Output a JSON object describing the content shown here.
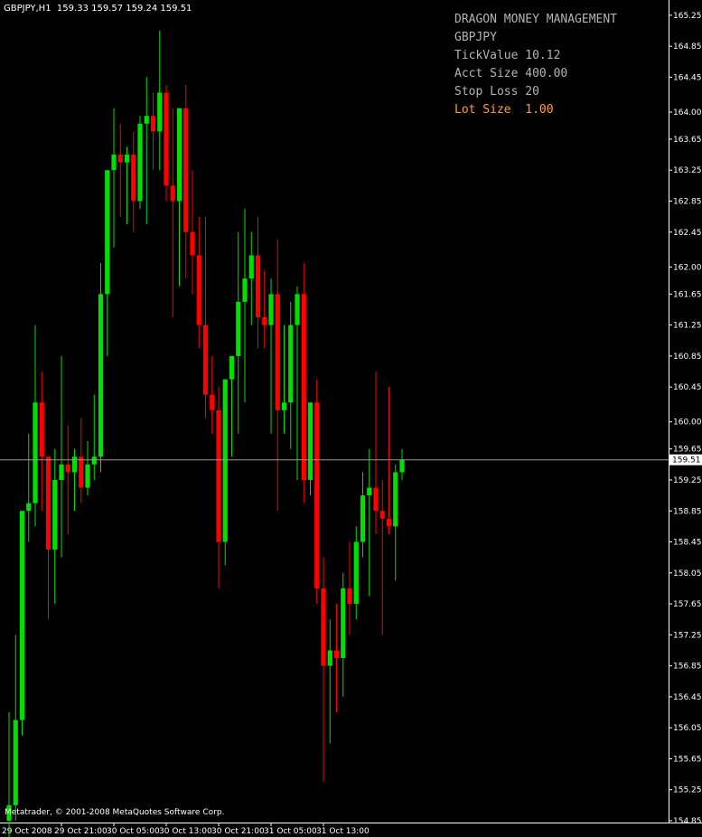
{
  "chart": {
    "symbol_header": "GBPJPY,H1  159.33 159.57 159.24 159.51",
    "current_price_label": "159.51",
    "copyright": "Metatrader, © 2001-2008 MetaQuotes Software Corp."
  },
  "info_panel": {
    "title": "DRAGON MONEY MANAGEMENT",
    "symbol": "GBPJPY",
    "tick_value": "TickValue 10.12",
    "acct_size": "Acct Size 400.00",
    "stop_loss": "Stop Loss 20",
    "lot_size": "Lot Size  1.00"
  },
  "colors": {
    "background": "#000000",
    "bull": "#00e000",
    "bear": "#ff0000",
    "axis": "#ffffff",
    "info_text": "#b4b4b4",
    "lot_text": "#ff9d3c"
  },
  "chart_data": {
    "type": "candlestick",
    "symbol": "GBPJPY",
    "timeframe": "H1",
    "ylim": [
      154.85,
      165.4
    ],
    "price_ticks": [
      "165.25",
      "164.85",
      "164.45",
      "164.00",
      "163.65",
      "163.25",
      "162.85",
      "162.45",
      "162.00",
      "161.65",
      "161.25",
      "160.85",
      "160.45",
      "160.00",
      "159.65",
      "159.25",
      "158.85",
      "158.45",
      "158.05",
      "157.65",
      "157.25",
      "156.85",
      "156.45",
      "156.05",
      "155.65",
      "155.25",
      "154.85"
    ],
    "time_ticks": [
      "29 Oct 2008",
      "29 Oct 21:00",
      "30 Oct 05:00",
      "30 Oct 13:00",
      "30 Oct 21:00",
      "31 Oct 05:00",
      "31 Oct 13:00"
    ],
    "current_price": 159.51,
    "candles": [
      [
        154.85,
        156.25,
        154.55,
        155.05
      ],
      [
        155.05,
        157.25,
        154.85,
        156.15
      ],
      [
        156.15,
        158.85,
        155.95,
        158.85
      ],
      [
        158.85,
        159.85,
        158.45,
        158.95
      ],
      [
        158.95,
        161.25,
        158.65,
        160.25
      ],
      [
        160.25,
        160.65,
        158.85,
        159.55
      ],
      [
        159.55,
        159.55,
        157.45,
        158.35
      ],
      [
        158.35,
        159.65,
        157.65,
        159.25
      ],
      [
        159.25,
        160.85,
        158.25,
        159.45
      ],
      [
        159.45,
        159.95,
        158.55,
        159.35
      ],
      [
        159.35,
        159.65,
        158.85,
        159.55
      ],
      [
        159.55,
        160.05,
        158.95,
        159.15
      ],
      [
        159.15,
        159.75,
        159.05,
        159.45
      ],
      [
        159.45,
        160.35,
        159.25,
        159.55
      ],
      [
        159.55,
        162.05,
        159.35,
        161.65
      ],
      [
        161.65,
        163.05,
        160.85,
        163.25
      ],
      [
        163.25,
        164.05,
        162.25,
        163.45
      ],
      [
        163.45,
        163.85,
        162.65,
        163.35
      ],
      [
        163.35,
        163.55,
        162.55,
        163.45
      ],
      [
        163.45,
        163.75,
        162.45,
        162.85
      ],
      [
        162.85,
        163.95,
        162.75,
        163.85
      ],
      [
        163.85,
        164.45,
        162.55,
        163.95
      ],
      [
        163.95,
        164.25,
        163.25,
        163.75
      ],
      [
        163.75,
        165.05,
        163.25,
        164.25
      ],
      [
        164.25,
        164.35,
        162.85,
        163.05
      ],
      [
        163.05,
        164.05,
        161.35,
        162.85
      ],
      [
        162.85,
        163.55,
        161.75,
        164.05
      ],
      [
        164.05,
        164.35,
        161.85,
        162.45
      ],
      [
        162.45,
        163.25,
        161.65,
        162.15
      ],
      [
        162.15,
        162.65,
        160.95,
        161.25
      ],
      [
        161.25,
        162.65,
        160.05,
        160.35
      ],
      [
        160.35,
        160.85,
        159.85,
        160.15
      ],
      [
        160.15,
        160.45,
        157.85,
        158.45
      ],
      [
        158.45,
        160.25,
        158.15,
        160.55
      ],
      [
        160.55,
        160.85,
        159.55,
        160.85
      ],
      [
        160.85,
        162.45,
        159.85,
        161.55
      ],
      [
        161.55,
        162.75,
        160.25,
        161.85
      ],
      [
        161.85,
        162.45,
        161.25,
        162.15
      ],
      [
        162.15,
        162.65,
        160.95,
        161.35
      ],
      [
        161.35,
        161.95,
        160.95,
        161.25
      ],
      [
        161.25,
        161.85,
        159.85,
        161.65
      ],
      [
        161.65,
        162.35,
        158.85,
        160.15
      ],
      [
        160.15,
        161.25,
        159.85,
        160.25
      ],
      [
        160.25,
        161.55,
        159.65,
        161.25
      ],
      [
        161.25,
        161.75,
        159.25,
        161.65
      ],
      [
        161.65,
        162.05,
        158.95,
        159.25
      ],
      [
        159.25,
        160.25,
        159.05,
        160.25
      ],
      [
        160.25,
        160.55,
        157.65,
        157.85
      ],
      [
        157.85,
        158.25,
        155.35,
        156.85
      ],
      [
        156.85,
        157.45,
        155.85,
        157.05
      ],
      [
        157.05,
        157.65,
        156.25,
        156.95
      ],
      [
        156.95,
        158.05,
        156.45,
        157.85
      ],
      [
        157.85,
        158.45,
        157.25,
        157.65
      ],
      [
        157.65,
        158.65,
        157.45,
        158.45
      ],
      [
        158.45,
        159.35,
        158.25,
        159.05
      ],
      [
        159.05,
        159.65,
        157.75,
        159.15
      ],
      [
        159.15,
        160.65,
        158.55,
        158.85
      ],
      [
        158.85,
        159.25,
        157.25,
        158.75
      ],
      [
        158.75,
        160.45,
        158.55,
        158.65
      ],
      [
        158.65,
        159.45,
        157.95,
        159.35
      ],
      [
        159.35,
        159.65,
        159.25,
        159.51
      ]
    ]
  }
}
